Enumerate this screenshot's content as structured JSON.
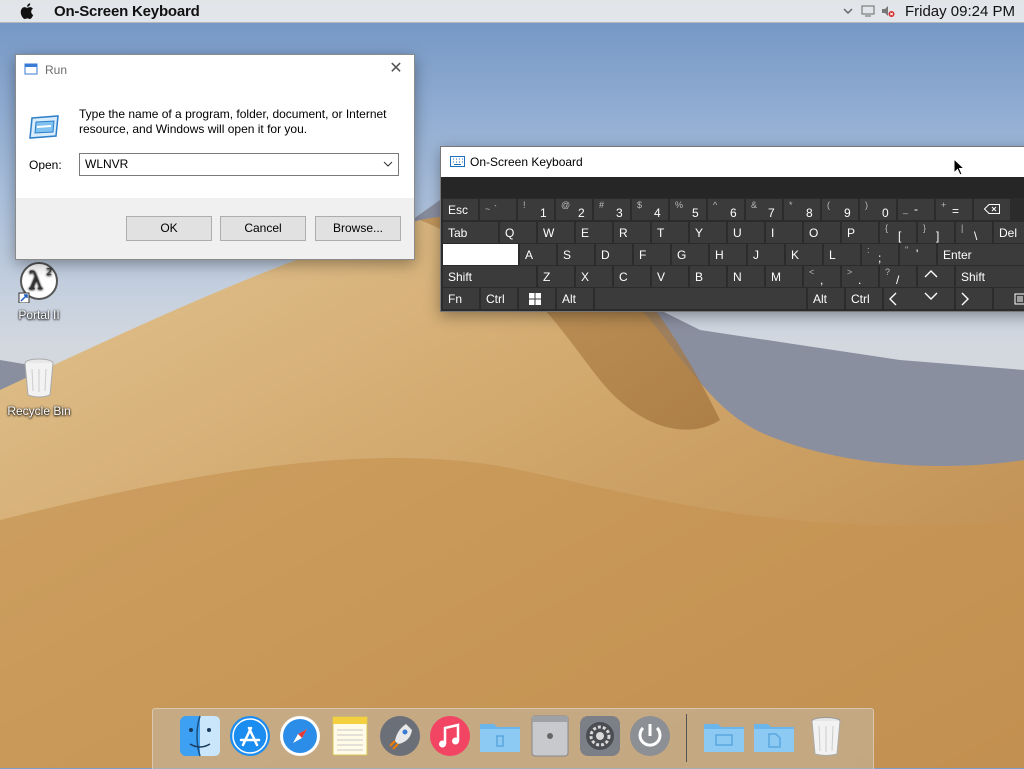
{
  "menubar": {
    "app_name": "On-Screen Keyboard",
    "clock": "Friday 09:24 PM",
    "icons": [
      "apple-icon",
      "chevron-down-icon",
      "notification-icon",
      "volume-muted-icon"
    ]
  },
  "desktop": {
    "icons": [
      {
        "label": "Portal II",
        "icon": "portal-2-icon"
      },
      {
        "label": "Recycle Bin",
        "icon": "recycle-bin-icon"
      }
    ]
  },
  "run_dialog": {
    "title": "Run",
    "description": "Type the name of a program, folder, document, or Internet resource, and Windows will open it for you.",
    "open_label": "Open:",
    "input_value": "WLNVR",
    "buttons": {
      "ok": "OK",
      "cancel": "Cancel",
      "browse": "Browse..."
    }
  },
  "osk": {
    "title": "On-Screen Keyboard",
    "keys": {
      "esc": "Esc",
      "tab": "Tab",
      "shift": "Shift",
      "shift_right": "Shift",
      "fn": "Fn",
      "ctrl": "Ctrl",
      "alt": "Alt",
      "alt_right": "Alt",
      "ctrl_right": "Ctrl",
      "enter": "Enter",
      "del": "Del",
      "tilde_shift": "~",
      "tilde_main": "`",
      "d1s": "!",
      "d1": "1",
      "d2s": "@",
      "d2": "2",
      "d3s": "#",
      "d3": "3",
      "d4s": "$",
      "d4": "4",
      "d5s": "%",
      "d5": "5",
      "d6s": "^",
      "d6": "6",
      "d7s": "&",
      "d7": "7",
      "d8s": "*",
      "d8": "8",
      "d9s": "(",
      "d9": "9",
      "d0s": ")",
      "d0": "0",
      "minus_s": "_",
      "minus": "-",
      "eq_s": "+",
      "eq": "=",
      "q": "Q",
      "w": "W",
      "e": "E",
      "r": "R",
      "t": "T",
      "y": "Y",
      "u": "U",
      "i": "I",
      "o": "O",
      "p": "P",
      "lbr_s": "{",
      "lbr": "[",
      "rbr_s": "}",
      "rbr": "]",
      "bs_s": "|",
      "bs": "\\",
      "a": "A",
      "s": "S",
      "d": "D",
      "f": "F",
      "g": "G",
      "h": "H",
      "j": "J",
      "k": "K",
      "l": "L",
      "semi_s": ":",
      "semi": ";",
      "quote_s": "\"",
      "quote": "'",
      "z": "Z",
      "x": "X",
      "c": "C",
      "v": "V",
      "b": "B",
      "n": "N",
      "m": "M",
      "comma_s": "<",
      "comma": ",",
      "dot_s": ">",
      "dot": ".",
      "slash_s": "?",
      "slash": "/"
    }
  },
  "dock": {
    "items": [
      "finder-icon",
      "app-store-icon",
      "safari-icon",
      "notes-icon",
      "launchpad-icon",
      "itunes-icon",
      "folder-icon",
      "mac-pro-icon",
      "system-preferences-icon",
      "power-icon",
      "folder-icon",
      "documents-folder-icon",
      "trash-icon"
    ]
  }
}
